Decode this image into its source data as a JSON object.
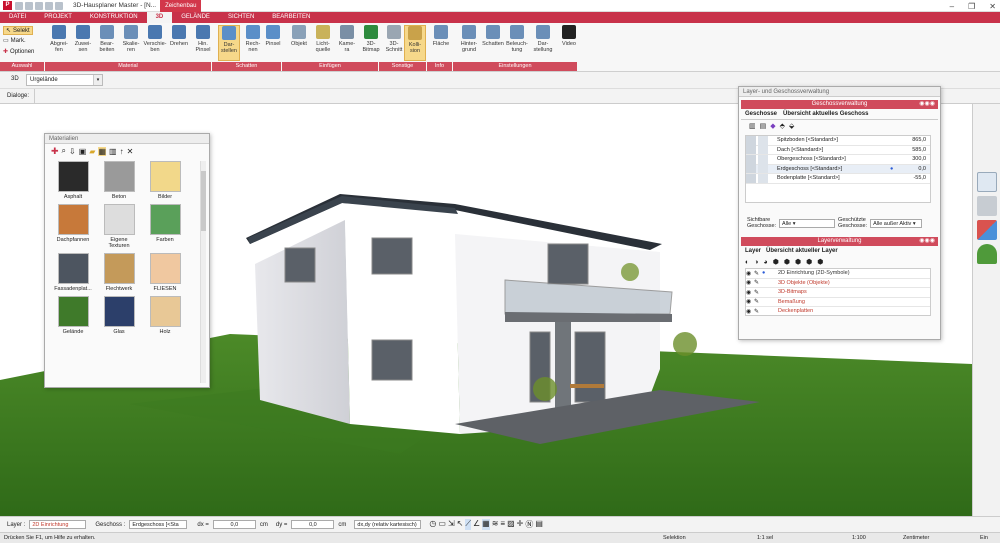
{
  "window": {
    "title": "3D-Hausplaner Master - [N...",
    "context_tab": "Zeichenbau",
    "buttons": [
      "–",
      "❐",
      "✕"
    ]
  },
  "menu_tabs": [
    "DATEI",
    "PROJEKT",
    "KONSTRUKTION",
    "3D",
    "GELÄNDE",
    "SICHTEN",
    "BEARBEITEN"
  ],
  "ribbon": {
    "auswahl": [
      "Selekt",
      "Mark.",
      "Optionen"
    ],
    "material": [
      {
        "label": "Abgrei-\nfen",
        "color": "#4a78b0"
      },
      {
        "label": "Zuwei-\nsen",
        "color": "#4a78b0"
      },
      {
        "label": "Bear-\nbeiten",
        "color": "#6b8fb8"
      },
      {
        "label": "Skalie-\nren",
        "color": "#6b8fb8"
      },
      {
        "label": "Verschie-\nben",
        "color": "#4a78b0"
      },
      {
        "label": "Drehen",
        "color": "#4a78b0"
      },
      {
        "label": "Hin.\nPinsel",
        "color": "#4a78b0"
      }
    ],
    "schatten": [
      {
        "label": "Dar-\nstellen",
        "color": "#5b8fc8",
        "selected": true
      },
      {
        "label": "Rech-\nnen",
        "color": "#5b8fc8"
      },
      {
        "label": "Pinsel",
        "color": "#5b8fc8"
      }
    ],
    "einfuegen": [
      {
        "label": "Objekt",
        "color": "#8aa1b8"
      },
      {
        "label": "Licht-\nquelle",
        "color": "#c9b25a"
      },
      {
        "label": "Kame-\nra",
        "color": "#7a8fa5"
      },
      {
        "label": "3D-\nBitmap",
        "color": "#2e8b3e"
      }
    ],
    "sonstige": [
      {
        "label": "3D-\nSchnitt",
        "color": "#9aa6b2"
      },
      {
        "label": "Kolli-\nsion",
        "color": "#c9a24a",
        "selected": true
      }
    ],
    "info": [
      {
        "label": "Fläche",
        "color": "#6b8fb8"
      }
    ],
    "einstellungen": [
      {
        "label": "Hinter-\ngrund",
        "color": "#6b8fb8"
      },
      {
        "label": "Schatten",
        "color": "#6b8fb8"
      },
      {
        "label": "Beleuch-\ntung",
        "color": "#6b8fb8"
      },
      {
        "label": "Dar-\nstellung",
        "color": "#6b8fb8"
      },
      {
        "label": "Video",
        "color": "#222"
      }
    ],
    "group_labels": [
      "Auswahl",
      "Material",
      "Schatten",
      "Einfügen",
      "Sonstige",
      "Info",
      "Einstellungen"
    ]
  },
  "toolbar2": {
    "view": "3D",
    "terrain": "Urgelände"
  },
  "toolbar3": {
    "label": "Dialoge:"
  },
  "materials_panel": {
    "title": "Materialien",
    "items": [
      {
        "label": "Asphalt",
        "color": "#2a2a2a"
      },
      {
        "label": "Beton",
        "color": "#9a9a9a"
      },
      {
        "label": "Bilder",
        "color": "#f2d88a"
      },
      {
        "label": "Dachpfannen",
        "color": "#c7793a"
      },
      {
        "label": "Eigene\nTexturen",
        "color": "#dddddd"
      },
      {
        "label": "Farben",
        "color": "#5aa05a"
      },
      {
        "label": "Fassadenplat...",
        "color": "#4d5560"
      },
      {
        "label": "Flechtwerk",
        "color": "#c49a5a"
      },
      {
        "label": "FLIESEN",
        "color": "#f0c8a0"
      },
      {
        "label": "Gelände",
        "color": "#3f7a2a"
      },
      {
        "label": "Glas",
        "color": "#2c3f6a"
      },
      {
        "label": "Holz",
        "color": "#e8c896"
      }
    ]
  },
  "layer_panel": {
    "title": "Layer- und Geschossverwaltung",
    "geschoss_header": "Geschossverwaltung",
    "tabs": [
      "Geschosse",
      "Übersicht aktuelles Geschoss"
    ],
    "floors": [
      {
        "name": "Spitzboden [<Standard>]",
        "height": "865,0"
      },
      {
        "name": "Dach [<Standard>]",
        "height": "585,0"
      },
      {
        "name": "Obergeschoss [<Standard>]",
        "height": "300,0"
      },
      {
        "name": "Erdgeschoss [<Standard>]",
        "height": "0,0"
      },
      {
        "name": "Bodenplatte [<Standard>]",
        "height": "-55,0"
      }
    ],
    "visible_label": "Sichtbare\nGeschosse:",
    "visible_value": "Alle",
    "protected_label": "Geschützte\nGeschosse:",
    "protected_value": "Alle außer Aktiv",
    "layer_header": "Layerverwaltung",
    "layer_tabs": [
      "Layer",
      "Übersicht aktueller Layer"
    ],
    "layers": [
      {
        "name": "2D Einrichtung (2D-Symbole)",
        "color": "#333"
      },
      {
        "name": "3D Objekte (Objekte)",
        "color": "#c0392b"
      },
      {
        "name": "3D-Bitmaps",
        "color": "#c0392b"
      },
      {
        "name": "Bemaßung",
        "color": "#c0392b"
      },
      {
        "name": "Deckenplatten",
        "color": "#c0392b"
      }
    ]
  },
  "status1": {
    "layer_label": "Layer :",
    "layer_value": "2D Einrichtung",
    "geschoss_label": "Geschoss :",
    "geschoss_value": "Erdgeschoss [<Sta",
    "dx_label": "dx =",
    "dx_value": "0,0",
    "unit1": "cm",
    "dy_label": "dy =",
    "dy_value": "0,0",
    "unit2": "cm",
    "coord_mode": "dx,dy (relativ kartesisch)"
  },
  "status2": {
    "hint": "Drücken Sie F1, um Hilfe zu erhalten.",
    "selection": "Selektion",
    "scale1": "1:1 sel",
    "scale2": "1:100",
    "unit": "Zentimeter",
    "lock": "Ein"
  }
}
